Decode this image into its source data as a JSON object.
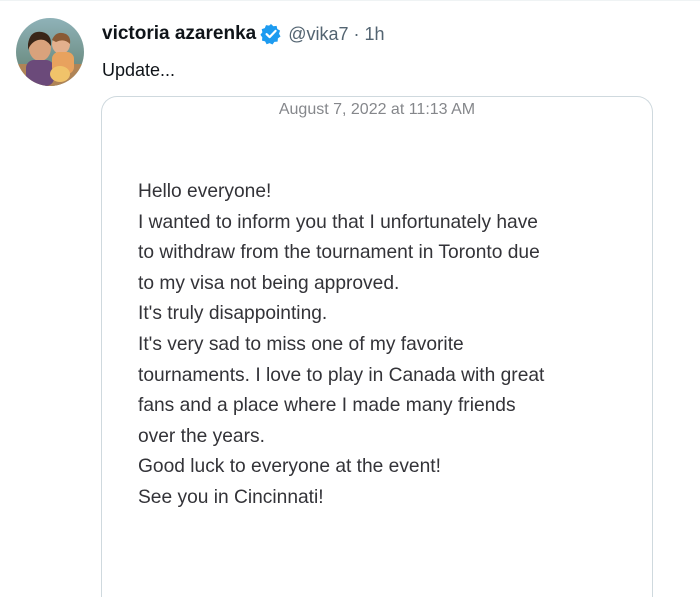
{
  "tweet": {
    "author": {
      "display_name": "victoria azarenka",
      "handle": "@vika7",
      "verified": true,
      "avatar_icon": "profile-photo-avatar"
    },
    "separator": "·",
    "time": "1h",
    "text": "Update...",
    "attachment": {
      "type": "notes-screenshot",
      "date": "August 7, 2022 at 11:13 AM",
      "lines": [
        "Hello everyone!",
        "I wanted to inform you that I unfortunately have",
        "to withdraw from the tournament in Toronto due",
        "to my visa not being approved.",
        "It's truly disappointing.",
        "It's very sad to miss one of my favorite",
        "tournaments. I love to play in Canada with great",
        "fans and a place where I made many friends",
        "over the years.",
        "Good luck to everyone at the event!",
        "See you in Cincinnati!"
      ]
    }
  },
  "colors": {
    "verified_badge": "#1d9bf0",
    "secondary_text": "#536471",
    "card_border": "#cfd9de",
    "note_text": "#333338",
    "note_date": "#85878b"
  }
}
